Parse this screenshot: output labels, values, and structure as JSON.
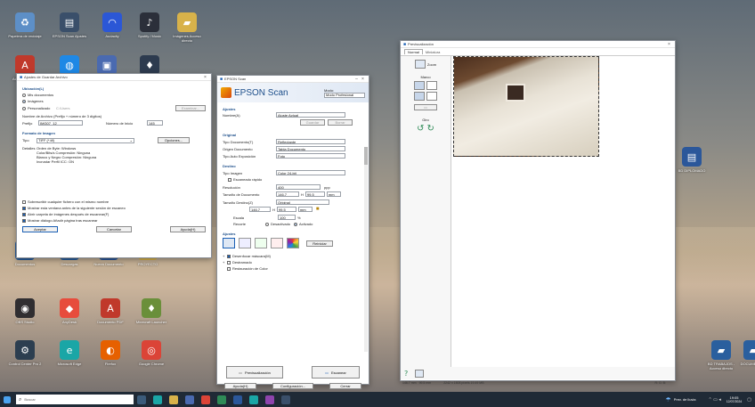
{
  "desktop_icons": [
    {
      "label": "Papelera de reciclaje",
      "icon": "recycle-bin-icon",
      "color": "#5d8fc7"
    },
    {
      "label": "EPSON Scan Ajustes",
      "icon": "scanner-icon",
      "color": "#3a4f6a"
    },
    {
      "label": "Audacity",
      "icon": "headphones-icon",
      "color": "#2b57d6"
    },
    {
      "label": "Spotify / Music",
      "icon": "music-icon",
      "color": "#2b2f3a"
    },
    {
      "label": "Imágenes Acceso directo",
      "icon": "folder-icon",
      "color": "#d8b24a"
    },
    {
      "label": "Acrobat Reader",
      "icon": "pdf-icon",
      "color": "#c0392b"
    },
    {
      "label": "",
      "icon": "globe-icon",
      "color": "#1e88e5"
    },
    {
      "label": "",
      "icon": "app-icon",
      "color": "#4a6ab0"
    },
    {
      "label": "",
      "icon": "game-icon",
      "color": "#2d3b4f"
    },
    {
      "label": "Documentos",
      "icon": "folder-icon",
      "color": "#2a5f9e"
    },
    {
      "label": "Descargas",
      "icon": "download-icon",
      "color": "#2a5f9e"
    },
    {
      "label": "Nuevo Documento",
      "icon": "document-icon",
      "color": "#2b579a"
    },
    {
      "label": "PROYECTO",
      "icon": "folder-icon",
      "color": "#d8b24a"
    },
    {
      "label": "OBS Studio",
      "icon": "obs-icon",
      "color": "#302e31"
    },
    {
      "label": "AnyDesk",
      "icon": "remote-icon",
      "color": "#e74c3c"
    },
    {
      "label": "Documento PDF",
      "icon": "pdf-icon",
      "color": "#c0392b"
    },
    {
      "label": "Minecraft Launcher",
      "icon": "game-icon",
      "color": "#6a8f3a"
    },
    {
      "label": "Control Center Pro 2",
      "icon": "gear-icon",
      "color": "#2c3e50"
    },
    {
      "label": "Microsoft Edge",
      "icon": "edge-icon",
      "color": "#1aa6a6"
    },
    {
      "label": "Firefox",
      "icon": "firefox-icon",
      "color": "#e66000"
    },
    {
      "label": "Google Chrome",
      "icon": "chrome-icon",
      "color": "#db4437"
    },
    {
      "label": "BD DIPLOMADO",
      "icon": "document-icon",
      "color": "#2b579a"
    },
    {
      "label": "BD TRABAJOS - Acceso directo",
      "icon": "folder-icon",
      "color": "#2a5f9e"
    },
    {
      "label": "DOCUMENTOS",
      "icon": "folder-icon",
      "color": "#2a5f9e"
    }
  ],
  "file_settings": {
    "title": "Ajustes de Guardar Archivo",
    "location_label": "Ubicación(L)",
    "loc_options": [
      "Mis documentos",
      "Imágenes",
      "Personalizado"
    ],
    "loc_custom_value": "C:\\Users",
    "examinar_label": "Examinar...",
    "name_group": "Nombre de Archivo (Prefijo + número de 3 dígitos)",
    "prefix_label": "Prefijo",
    "prefix_value": "IMG07_12",
    "start_number_label": "Número de Inicio",
    "start_number_value": "145",
    "format_group": "Formato de Imagen",
    "type_label": "Tipo",
    "type_value": "TIFF (*.tif)",
    "options_label": "Opciones...",
    "details_label": "Detalles",
    "details_text": "Orden de Byte: Windows\nColor/Bits/s Compresión: Ninguna\nBlanco y Negro Compresión: Ninguna\nIncrustar Perfil ICC: ON",
    "checks": [
      "Sobrescribir cualquier fichero con el mismo nombre",
      "Mostrar esta ventana antes de la siguiente sesión de escaneo",
      "Abrir carpeta de imágenes después de escanear(F)",
      "Mostrar diálogo Añadir página tras escanear"
    ],
    "accept_label": "Aceptar",
    "cancel_label": "Cancelar",
    "help_label": "Ayuda(H)"
  },
  "epson": {
    "title": "EPSON Scan",
    "brand": "EPSON Scan",
    "mode_label": "Modo:",
    "mode_value": "Modo Profesional",
    "settings_group": "Ajustes",
    "name_label": "Nombre(A)",
    "name_value": "Ajuste Actual",
    "save_label": "Guardar",
    "delete_label": "Borrar",
    "original_group": "Original",
    "doc_type_label": "Tipo Documento(T)",
    "doc_type_value": "Reflectante",
    "doc_source_label": "Origen Documento",
    "doc_source_value": "Tabla Documento",
    "auto_exposure_label": "Tipo Auto Exposición",
    "auto_exposure_value": "Foto",
    "dest_group": "Destino",
    "image_type_label": "Tipo Imagen",
    "image_type_value": "Color 24-bit",
    "quick_scan_label": "Escaneado rápido",
    "resolution_label": "Resolución",
    "resolution_value": "400",
    "resolution_unit": "ppp",
    "doc_size_label": "Tamaño de Documento",
    "doc_w": "146.7",
    "doc_h": "99.5",
    "size_unit": "mm",
    "target_size_label": "Tamaño Destino(Z)",
    "target_size_value": "Original",
    "target_w": "146.7",
    "target_h": "99.5",
    "scale_label": "Escala",
    "scale_value": "100",
    "crop_label": "Recorte",
    "crop_off": "Desactivado",
    "crop_on": "Activado",
    "adjust_group": "Ajustes",
    "reset_label": "Reiniciar",
    "unsharp_label": "Desenfocar máscara(M)",
    "descreen_label": "Destramado",
    "color_restore_label": "Restauración de Color",
    "preview_label": "Previsualización",
    "scan_label": "Escanear",
    "help_label": "Ayuda(H)",
    "config_label": "Configuración...",
    "close_label": "Cerrar"
  },
  "preview": {
    "title": "Previsualización",
    "tabs": [
      "Normal",
      "Miniatura"
    ],
    "zoom_label": "Zoom",
    "marco_label": "Marco",
    "giro_label": "Giro",
    "status_size": "146.7 mm",
    "status_h": "99.5 mm",
    "status_pixels": "2242 x 1508 píxels 19.49 MB",
    "status_rgb": "R: G: B:"
  },
  "taskbar": {
    "search_placeholder": "Buscar",
    "tray_text": "Prev. de lluvia",
    "time": "19:05",
    "date": "12/07/2024"
  }
}
